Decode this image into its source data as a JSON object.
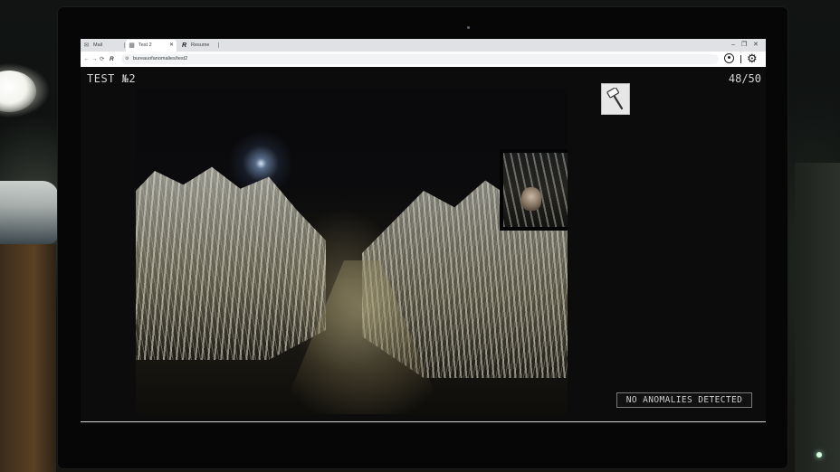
{
  "browser": {
    "tabs": [
      {
        "label": "Mail",
        "icon": "mail-icon",
        "active": false
      },
      {
        "label": "Test 2",
        "icon": "checkered-icon",
        "active": true
      },
      {
        "label": "Resume",
        "icon": "r-logo-icon",
        "active": false
      }
    ],
    "address": "bureauofanomalies/test2",
    "window_controls": [
      "–",
      "❐",
      "✕"
    ]
  },
  "page": {
    "title": "TEST №2",
    "counter": "48/50",
    "status": "NO ANOMALIES DETECTED",
    "tool": "magnifier-stamp-icon"
  },
  "colors": {
    "page_bg": "#0c0c0c",
    "text": "#d6d6d6",
    "tool_bg": "#e7e7e7"
  }
}
